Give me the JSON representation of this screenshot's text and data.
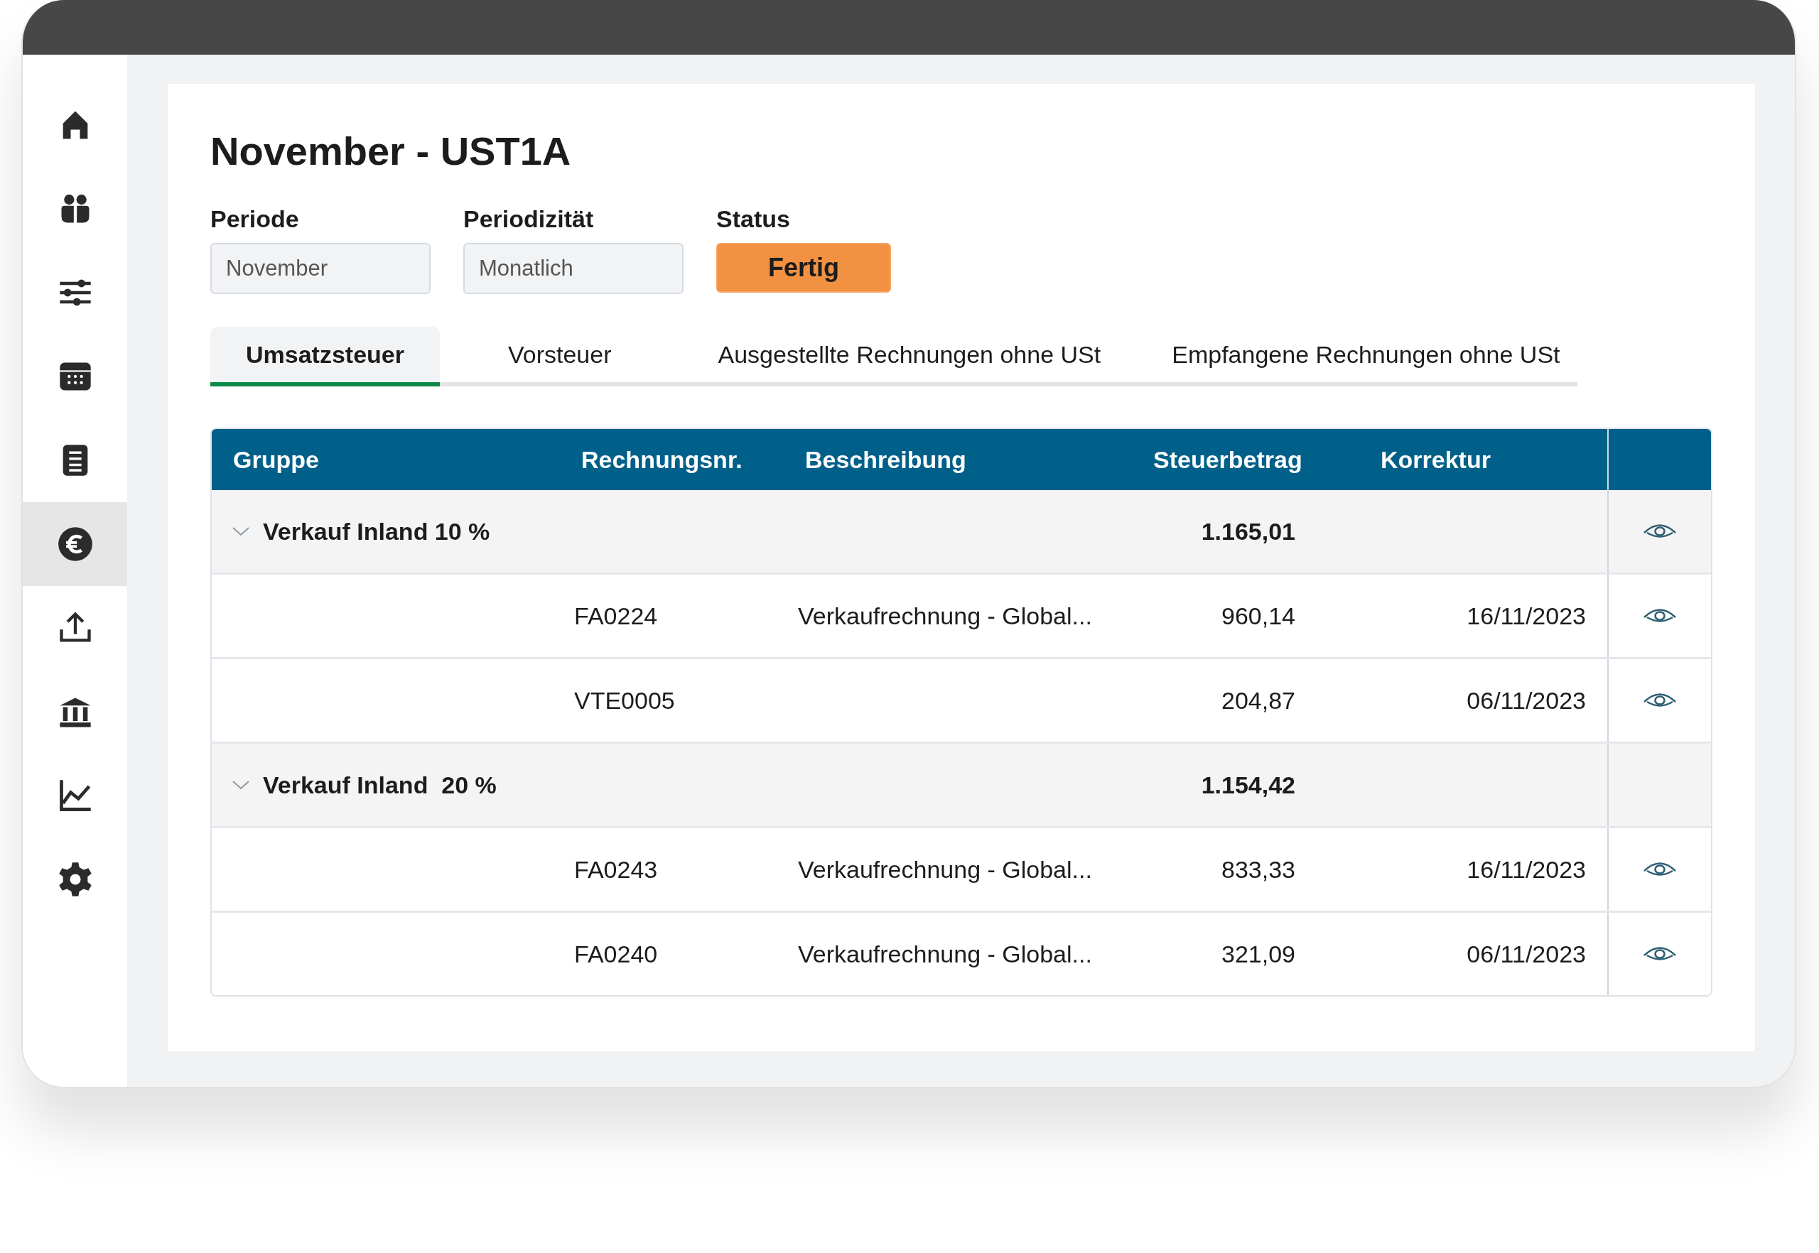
{
  "sidebar": {
    "items": [
      {
        "kind": "home",
        "selected": false
      },
      {
        "kind": "people",
        "selected": false
      },
      {
        "kind": "sliders",
        "selected": false
      },
      {
        "kind": "calendar",
        "selected": false
      },
      {
        "kind": "document",
        "selected": false
      },
      {
        "kind": "euro",
        "selected": true
      },
      {
        "kind": "upload",
        "selected": false
      },
      {
        "kind": "bank",
        "selected": false
      },
      {
        "kind": "chart",
        "selected": false
      },
      {
        "kind": "settings",
        "selected": false
      }
    ]
  },
  "title": "November - UST1A",
  "fields": [
    {
      "label": "Periode",
      "value": "November"
    },
    {
      "label": "Periodizität",
      "value": "Monatlich"
    }
  ],
  "status": {
    "label": "Status",
    "value": "Fertig"
  },
  "tabs": [
    {
      "label": "Umsatzsteuer",
      "selected": true
    },
    {
      "label": "Vorsteuer",
      "selected": false
    },
    {
      "label": "Ausgestellte Rechnungen ohne USt",
      "selected": false
    },
    {
      "label": "Empfangene Rechnungen ohne USt",
      "selected": false
    }
  ],
  "table": {
    "columns": [
      "Gruppe",
      "Rechnungsnr.",
      "Beschreibung",
      "Steuerbetrag",
      "Korrektur"
    ],
    "rows": [
      {
        "kind": "group",
        "expanded": true,
        "name": "Verkauf Inland 10 %",
        "amount": "1.165,01",
        "viewable": true
      },
      {
        "kind": "item",
        "number": "FA0224",
        "description": "Verkaufrechnung - Global...",
        "amount": "960,14",
        "correction": "16/11/2023",
        "viewable": true
      },
      {
        "kind": "item",
        "number": "VTE0005",
        "amount": "204,87",
        "correction": "06/11/2023",
        "viewable": true
      },
      {
        "kind": "group",
        "expanded": true,
        "name": "Verkauf Inland  20 %",
        "amount": "1.154,42",
        "viewable": false
      },
      {
        "kind": "item",
        "number": "FA0243",
        "description": "Verkaufrechnung - Global...",
        "amount": "833,33",
        "correction": "16/11/2023",
        "viewable": true
      },
      {
        "kind": "item",
        "number": "FA0240",
        "description": "Verkaufrechnung - Global...",
        "amount": "321,09",
        "correction": "06/11/2023",
        "viewable": true
      }
    ]
  }
}
